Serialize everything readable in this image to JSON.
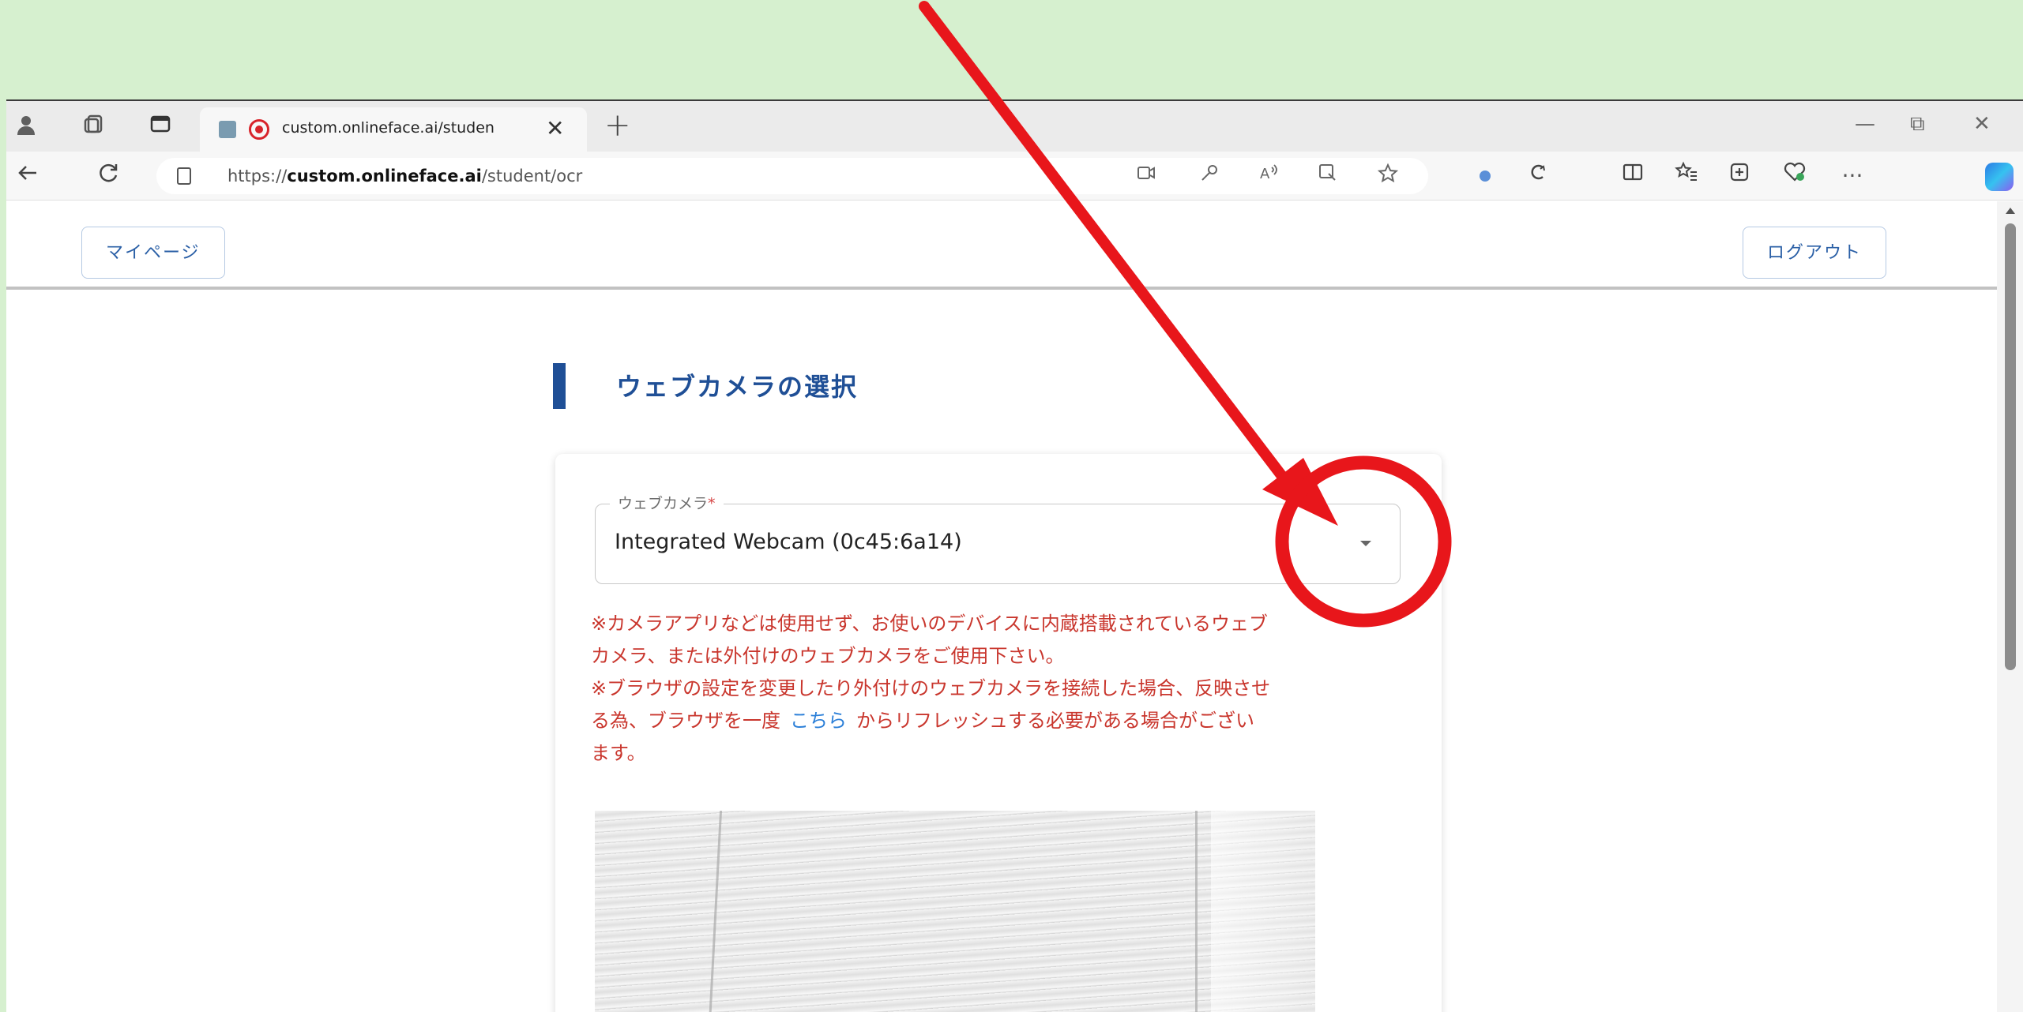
{
  "browser": {
    "tab_title": "custom.onlineface.ai/studen",
    "tab_close": "✕",
    "new_tab": "+",
    "url_prefix": "https://",
    "url_host": "custom.onlineface.ai",
    "url_path": "/student/ocr",
    "window_controls": {
      "minimize": "—",
      "restore": "⧉",
      "close": "✕"
    },
    "more_menu": "···"
  },
  "header": {
    "mypage_label": "マイページ",
    "logout_label": "ログアウト"
  },
  "section": {
    "title": "ウェブカメラの選択"
  },
  "camera_select": {
    "label": "ウェブカメラ",
    "required_mark": "*",
    "value": "Integrated Webcam (0c45:6a14)"
  },
  "notes": {
    "line1": "※カメラアプリなどは使用せず、お使いのデバイスに内蔵搭載されているウェブ",
    "line2": "カメラ、または外付けのウェブカメラをご使用下さい。",
    "line3": "※ブラウザの設定を変更したり外付けのウェブカメラを接続した場合、反映させ",
    "line4_pre": "る為、ブラウザを一度",
    "link": "こちら",
    "line4_post": "からリフレッシュする必要がある場合がござい",
    "line5": "ます。"
  },
  "colors": {
    "background": "#d6f0cf",
    "accent_blue": "#1f4f96",
    "note_red": "#c9362d",
    "link_blue": "#2b7fd8",
    "annotation_red": "#e8161b"
  },
  "icons": [
    "profile-icon",
    "workspaces-icon",
    "tab-actions-icon",
    "back-icon",
    "refresh-icon",
    "lock-icon",
    "favorites-icon",
    "copilot-icon",
    "dropdown-caret-icon"
  ]
}
